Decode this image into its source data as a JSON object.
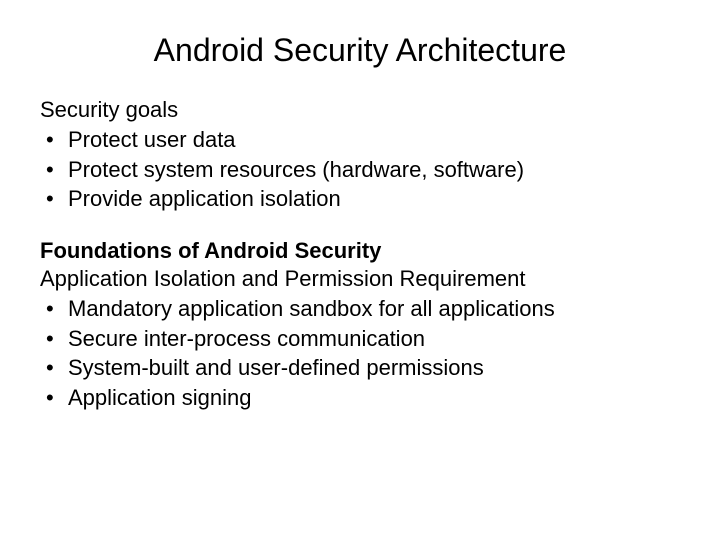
{
  "title": "Android Security Architecture",
  "section1": {
    "heading": "Security goals",
    "bullets": [
      "Protect user data",
      "Protect system resources (hardware, software)",
      "Provide application isolation"
    ]
  },
  "section2": {
    "heading": "Foundations  of  Android  Security",
    "subheading": "Application  Isolation  and  Permission Requirement",
    "bullets": [
      "Mandatory application sandbox for all applications",
      "Secure inter-process communication",
      "System-built and user-defined permissions",
      "Application signing"
    ]
  }
}
